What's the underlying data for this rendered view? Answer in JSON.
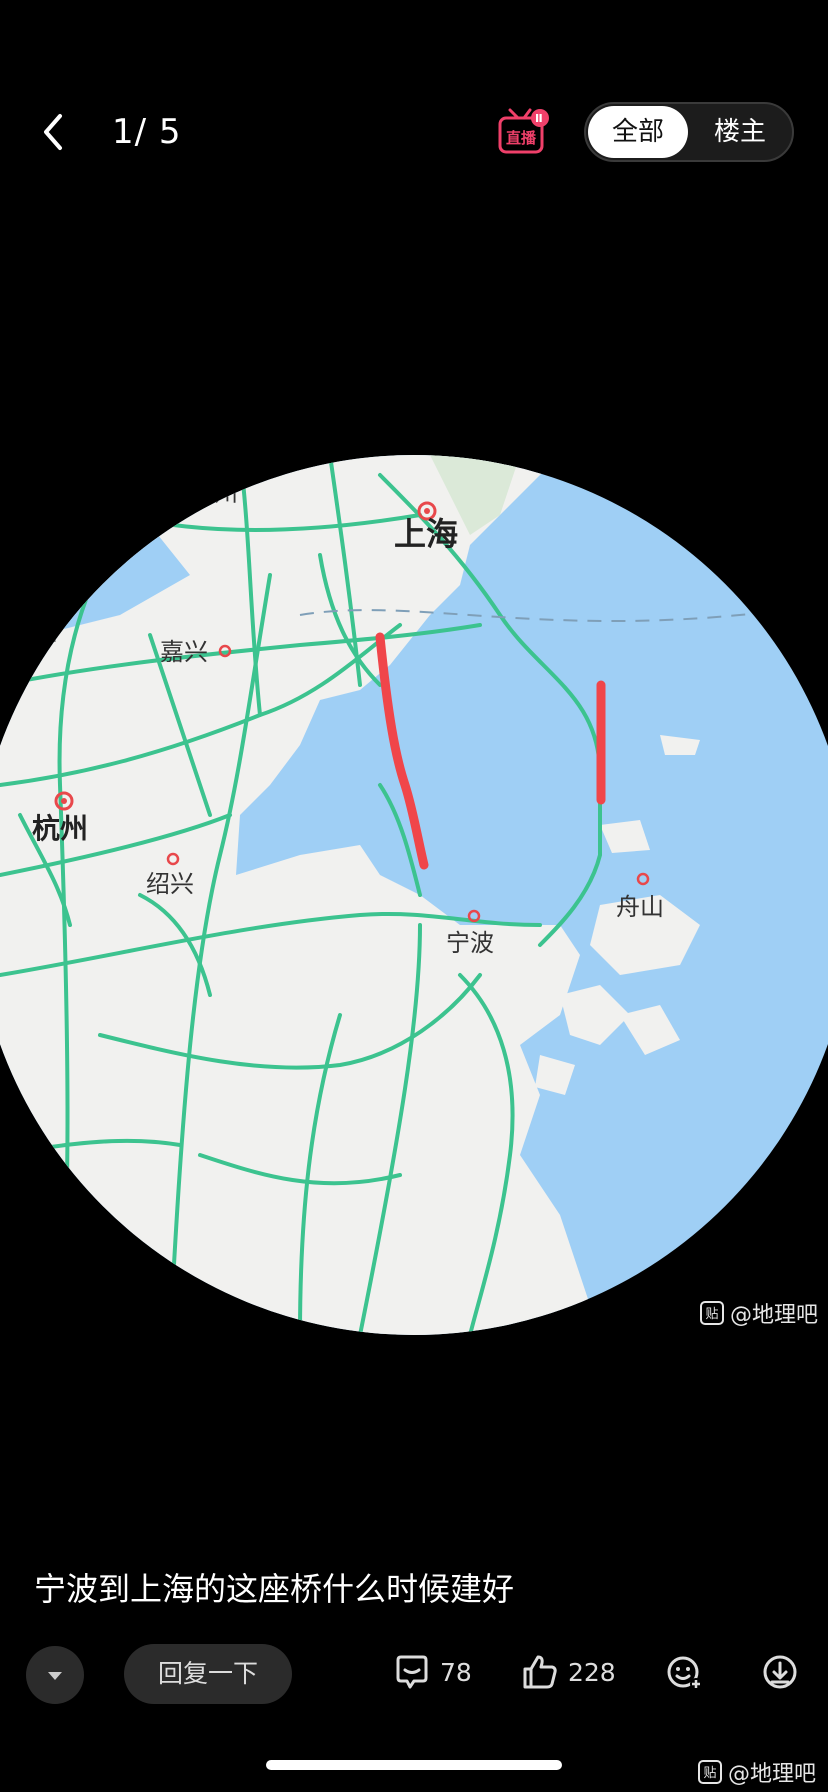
{
  "header": {
    "page_counter": "1/ 5",
    "live_label": "直播",
    "tabs": [
      "全部",
      "楼主"
    ]
  },
  "map": {
    "cities": [
      "苏州",
      "上海",
      "嘉兴",
      "杭州",
      "绍兴",
      "宁波",
      "舟山",
      "州"
    ],
    "route_color": "#f0464a",
    "sea_color": "#9fcff5",
    "land_color": "#f1f1ef",
    "road_color": "#3cc38f"
  },
  "watermarks": [
    "@地理吧",
    "@地理吧"
  ],
  "watermark_icon": "贴",
  "post": {
    "caption": "宁波到上海的这座桥什么时候建好"
  },
  "actions": {
    "reply_label": "回复一下",
    "comments": "78",
    "likes": "228"
  }
}
